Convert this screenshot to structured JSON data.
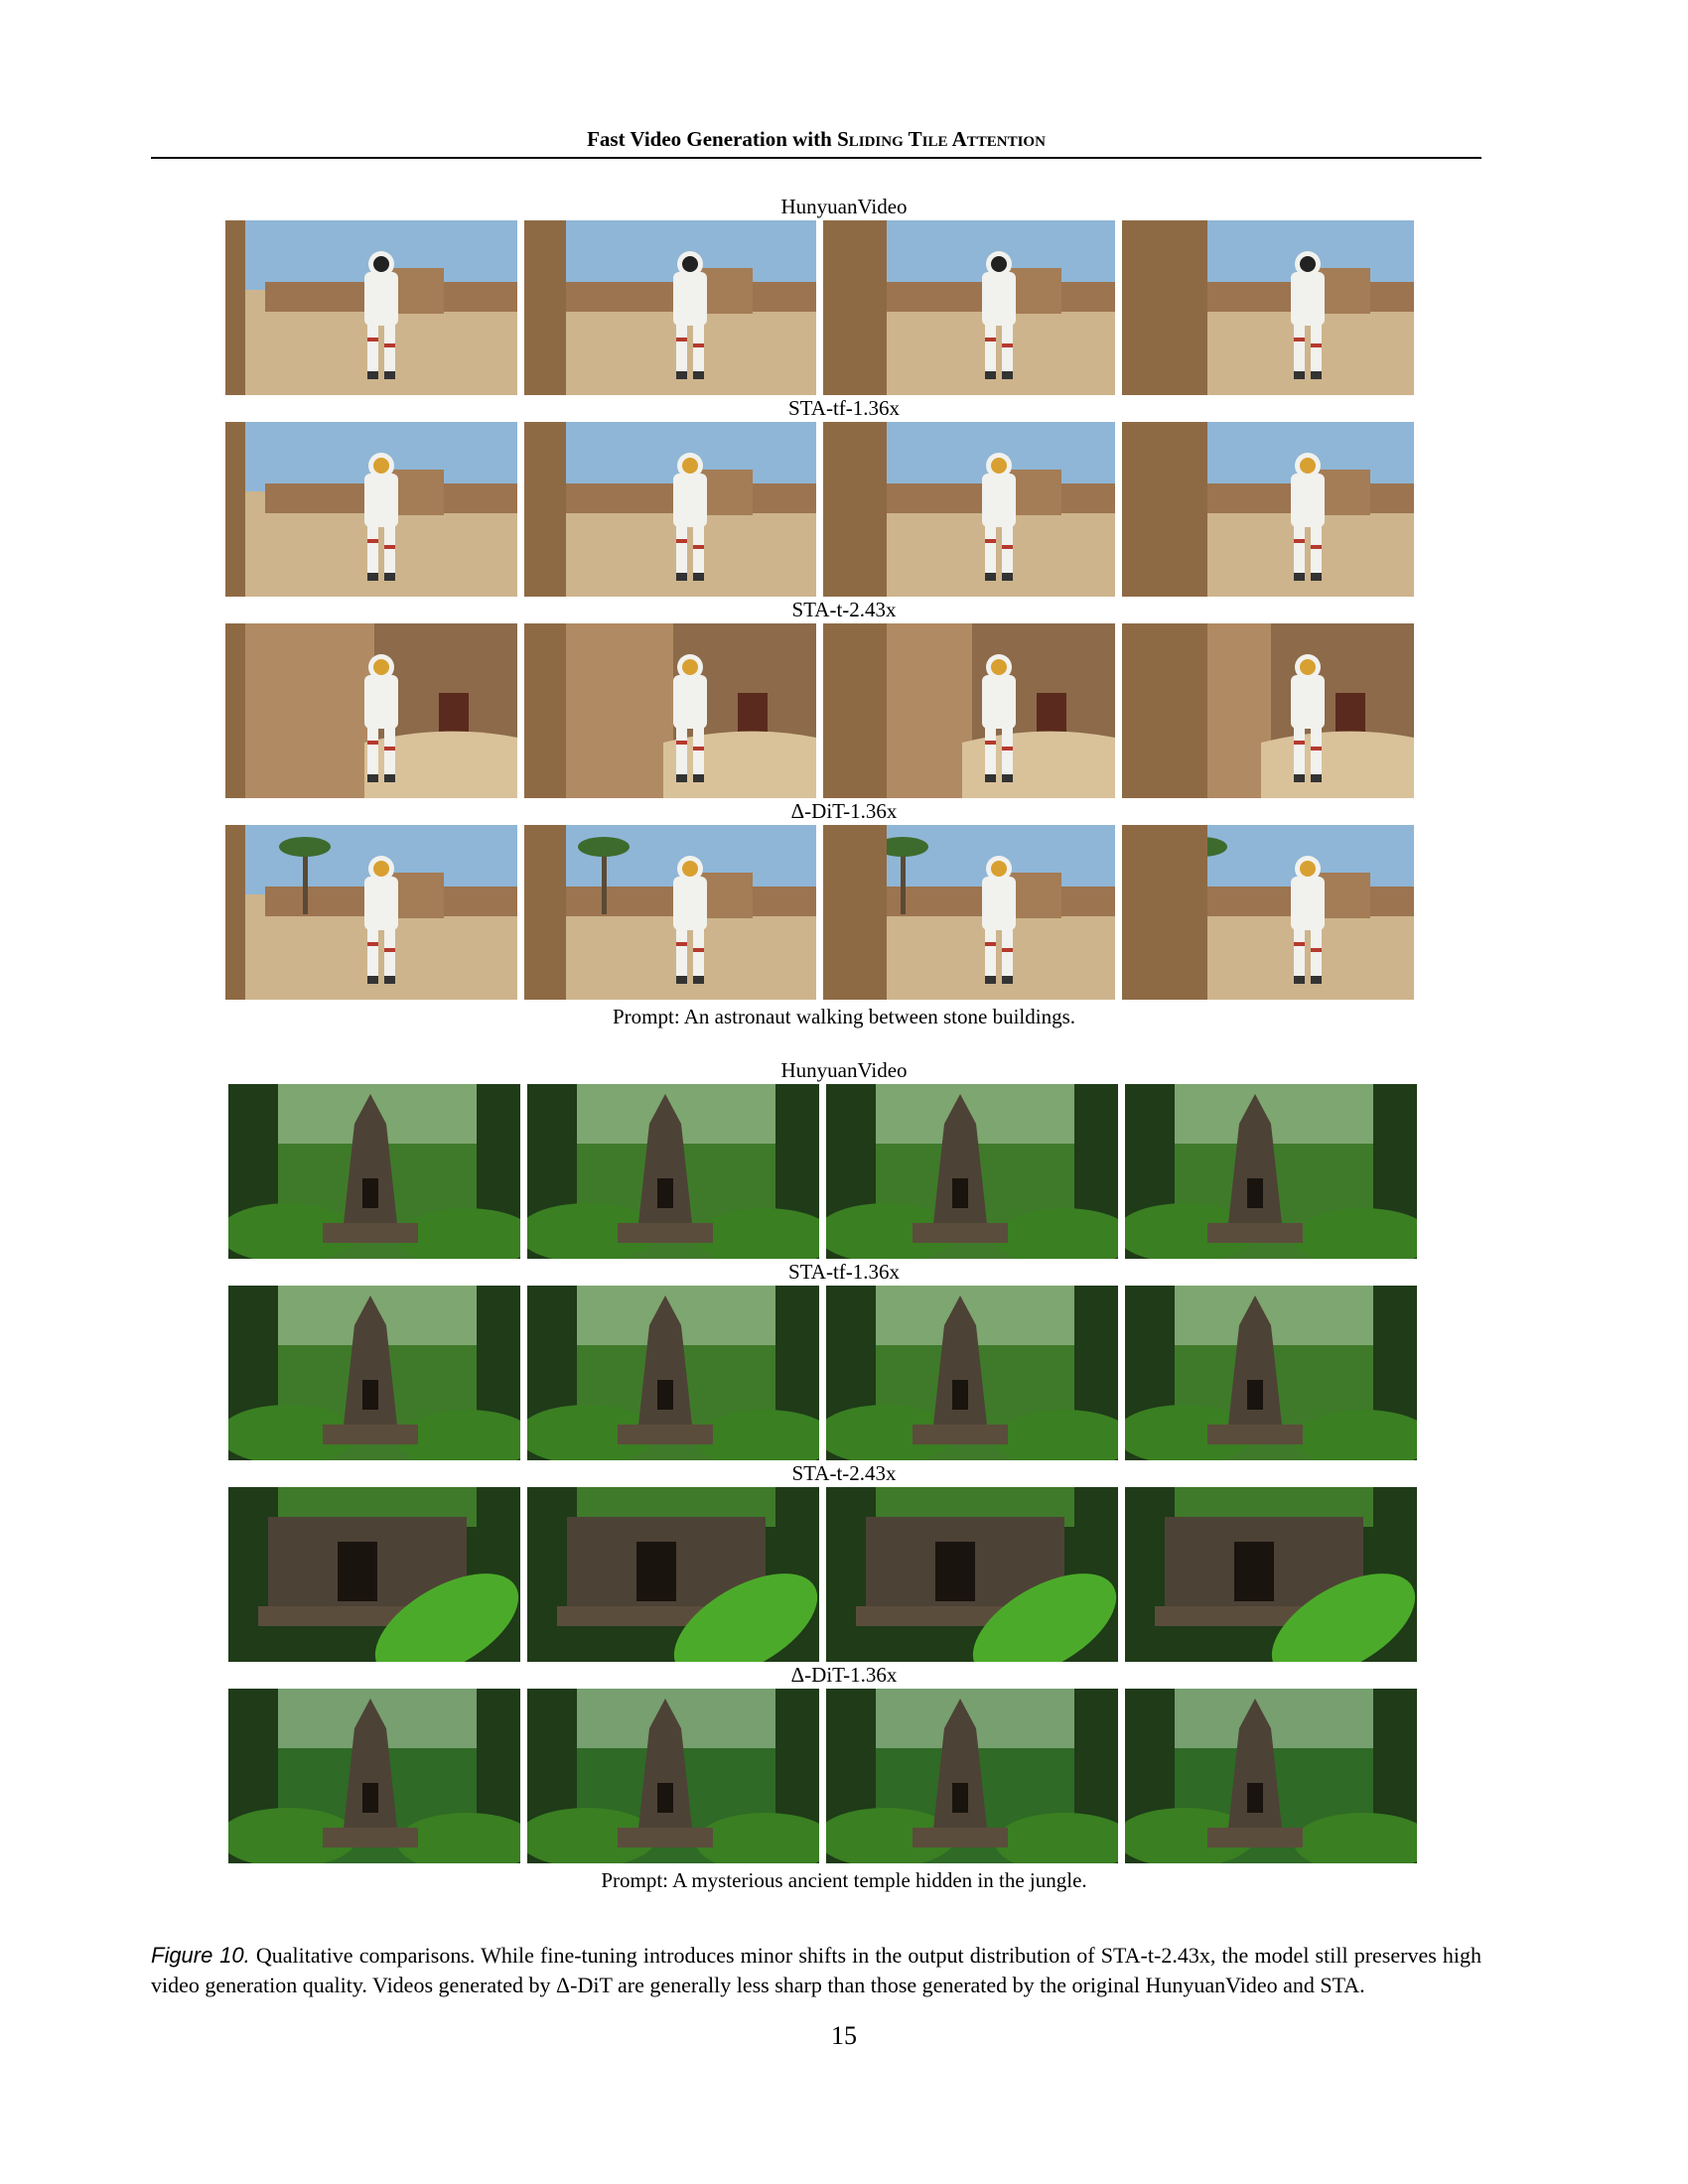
{
  "header": {
    "title_prefix": "Fast Video Generation with",
    "title_smallcaps": "Sliding Tile Attention"
  },
  "figure": {
    "groups": [
      {
        "prompt": "Prompt: An astronaut walking between stone buildings.",
        "scene": "astronaut",
        "rows": [
          {
            "label": "HunyuanVideo"
          },
          {
            "label": "STA-tf-1.36x"
          },
          {
            "label": "STA-t-2.43x"
          },
          {
            "label": "Δ-DiT-1.36x"
          }
        ]
      },
      {
        "prompt": "Prompt: A mysterious ancient temple hidden in the jungle.",
        "scene": "temple",
        "rows": [
          {
            "label": "HunyuanVideo"
          },
          {
            "label": "STA-tf-1.36x"
          },
          {
            "label": "STA-t-2.43x"
          },
          {
            "label": "Δ-DiT-1.36x"
          }
        ]
      }
    ],
    "caption_label": "Figure 10.",
    "caption_text": "Qualitative comparisons. While fine-tuning introduces minor shifts in the output distribution of STA-t-2.43x, the model still preserves high video generation quality. Videos generated by Δ-DiT are generally less sharp than those generated by the original HunyuanVideo and STA."
  },
  "page_number": "15",
  "colors": {
    "sky": "#8fb6d6",
    "sand": "#cdb48c",
    "stone": "#9c7450",
    "suit": "#f1f1ee",
    "stripe": "#b53a2e",
    "jungle_dark": "#1f3b18",
    "jungle": "#3f7a2a",
    "temple": "#4d4236"
  }
}
